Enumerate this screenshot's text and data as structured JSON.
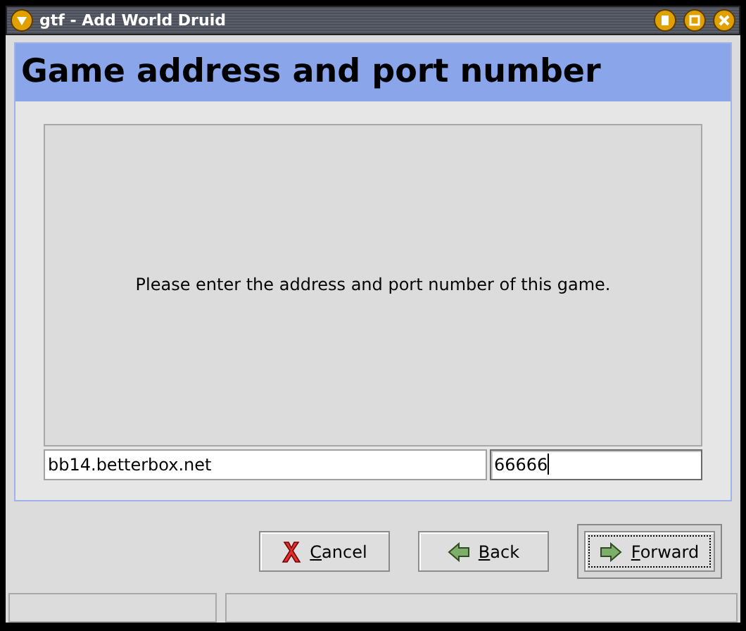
{
  "window": {
    "title": "gtf - Add World Druid"
  },
  "page": {
    "heading": "Game address and port number",
    "message": "Please enter the address and port number of this game."
  },
  "fields": [
    {
      "kind": "address",
      "value": "bb14.betterbox.net",
      "focused": false
    },
    {
      "kind": "port",
      "value": "66666",
      "focused": true
    }
  ],
  "buttons": [
    {
      "kind": "cancel",
      "label": "Cancel",
      "default": false
    },
    {
      "kind": "back",
      "label": "Back",
      "default": false
    },
    {
      "kind": "forward",
      "label": "Forward",
      "default": true
    }
  ]
}
